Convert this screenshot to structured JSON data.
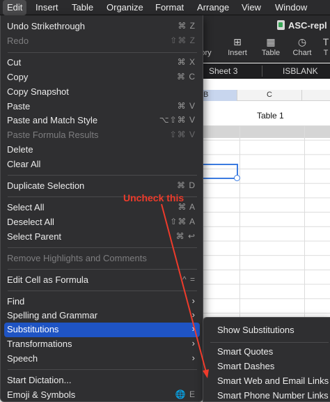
{
  "menubar": {
    "items": [
      "Edit",
      "Insert",
      "Table",
      "Organize",
      "Format",
      "Arrange",
      "View",
      "Window"
    ],
    "active": "Edit"
  },
  "document": {
    "title": "ASC-repl",
    "toolbar": {
      "overflow_label": "ory",
      "insert_label": "Insert",
      "table_label": "Table",
      "chart_label": "Chart",
      "more_label": "T"
    },
    "sheets": [
      "Sheet 3",
      "ISBLANK"
    ],
    "columns": [
      "B",
      "C"
    ],
    "table_title": "Table 1"
  },
  "edit_menu": {
    "items": [
      {
        "label": "Undo Strikethrough",
        "shortcut": "⌘ Z",
        "enabled": true
      },
      {
        "label": "Redo",
        "shortcut": "⇧⌘ Z",
        "enabled": false
      },
      {
        "label": "Cut",
        "shortcut": "⌘ X",
        "enabled": true
      },
      {
        "label": "Copy",
        "shortcut": "⌘ C",
        "enabled": true
      },
      {
        "label": "Copy Snapshot",
        "shortcut": "",
        "enabled": true
      },
      {
        "label": "Paste",
        "shortcut": "⌘ V",
        "enabled": true
      },
      {
        "label": "Paste and Match Style",
        "shortcut": "⌥⇧⌘ V",
        "enabled": true
      },
      {
        "label": "Paste Formula Results",
        "shortcut": "⇧⌘ V",
        "enabled": false
      },
      {
        "label": "Delete",
        "shortcut": "",
        "enabled": true
      },
      {
        "label": "Clear All",
        "shortcut": "",
        "enabled": true
      },
      {
        "label": "Duplicate Selection",
        "shortcut": "⌘ D",
        "enabled": true
      },
      {
        "label": "Select All",
        "shortcut": "⌘ A",
        "enabled": true
      },
      {
        "label": "Deselect All",
        "shortcut": "⇧⌘ A",
        "enabled": true
      },
      {
        "label": "Select Parent",
        "shortcut": "⌘ ↩",
        "enabled": true
      },
      {
        "label": "Remove Highlights and Comments",
        "shortcut": "",
        "enabled": false
      },
      {
        "label": "Edit Cell as Formula",
        "shortcut": "^ =",
        "enabled": true
      },
      {
        "label": "Find",
        "submenu": true,
        "enabled": true
      },
      {
        "label": "Spelling and Grammar",
        "submenu": true,
        "enabled": true
      },
      {
        "label": "Substitutions",
        "submenu": true,
        "enabled": true,
        "highlighted": true
      },
      {
        "label": "Transformations",
        "submenu": true,
        "enabled": true
      },
      {
        "label": "Speech",
        "submenu": true,
        "enabled": true
      },
      {
        "label": "Start Dictation...",
        "shortcut": "",
        "enabled": true
      },
      {
        "label": "Emoji & Symbols",
        "shortcut": "🌐 E",
        "enabled": true
      }
    ]
  },
  "substitutions_menu": {
    "items": [
      "Show Substitutions",
      "Smart Quotes",
      "Smart Dashes",
      "Smart Web and Email Links",
      "Smart Phone Number Links"
    ]
  },
  "annotation": {
    "text": "Uncheck this",
    "color": "#ee3b2b"
  },
  "colors": {
    "menu_background": "#2f2f31",
    "highlight": "#1f54c4",
    "selection_border": "#3b7be0"
  }
}
